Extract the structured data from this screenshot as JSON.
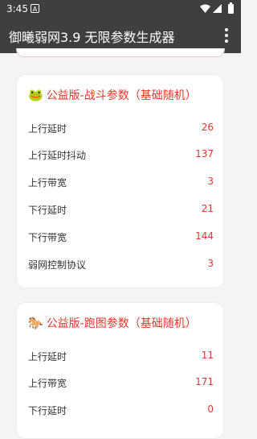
{
  "status_bar": {
    "time": "3:45",
    "sim_badge": "A",
    "wifi_icon": "wifi-icon",
    "signal_icon": "signal-icon",
    "battery_icon": "battery-icon"
  },
  "app_bar": {
    "title": "御曦弱网3.9 无限参数生成器",
    "menu_icon": "more-vert-icon"
  },
  "cards": [
    {
      "emoji": "🐸",
      "title": "公益版-战斗参数（基础随机）",
      "rows": [
        {
          "label": "上行延时",
          "value": "26"
        },
        {
          "label": "上行延时抖动",
          "value": "137"
        },
        {
          "label": "上行带宽",
          "value": "3"
        },
        {
          "label": "下行延时",
          "value": "21"
        },
        {
          "label": "下行带宽",
          "value": "144"
        },
        {
          "label": "弱网控制协议",
          "value": "3"
        }
      ]
    },
    {
      "emoji": "🐎",
      "title": "公益版-跑图参数（基础随机）",
      "rows": [
        {
          "label": "上行延时",
          "value": "11"
        },
        {
          "label": "上行带宽",
          "value": "171"
        },
        {
          "label": "下行延时",
          "value": "0"
        }
      ]
    }
  ],
  "colors": {
    "accent": "#e0392b",
    "app_bar": "#3f3f3f",
    "background": "#f4f4f6"
  }
}
